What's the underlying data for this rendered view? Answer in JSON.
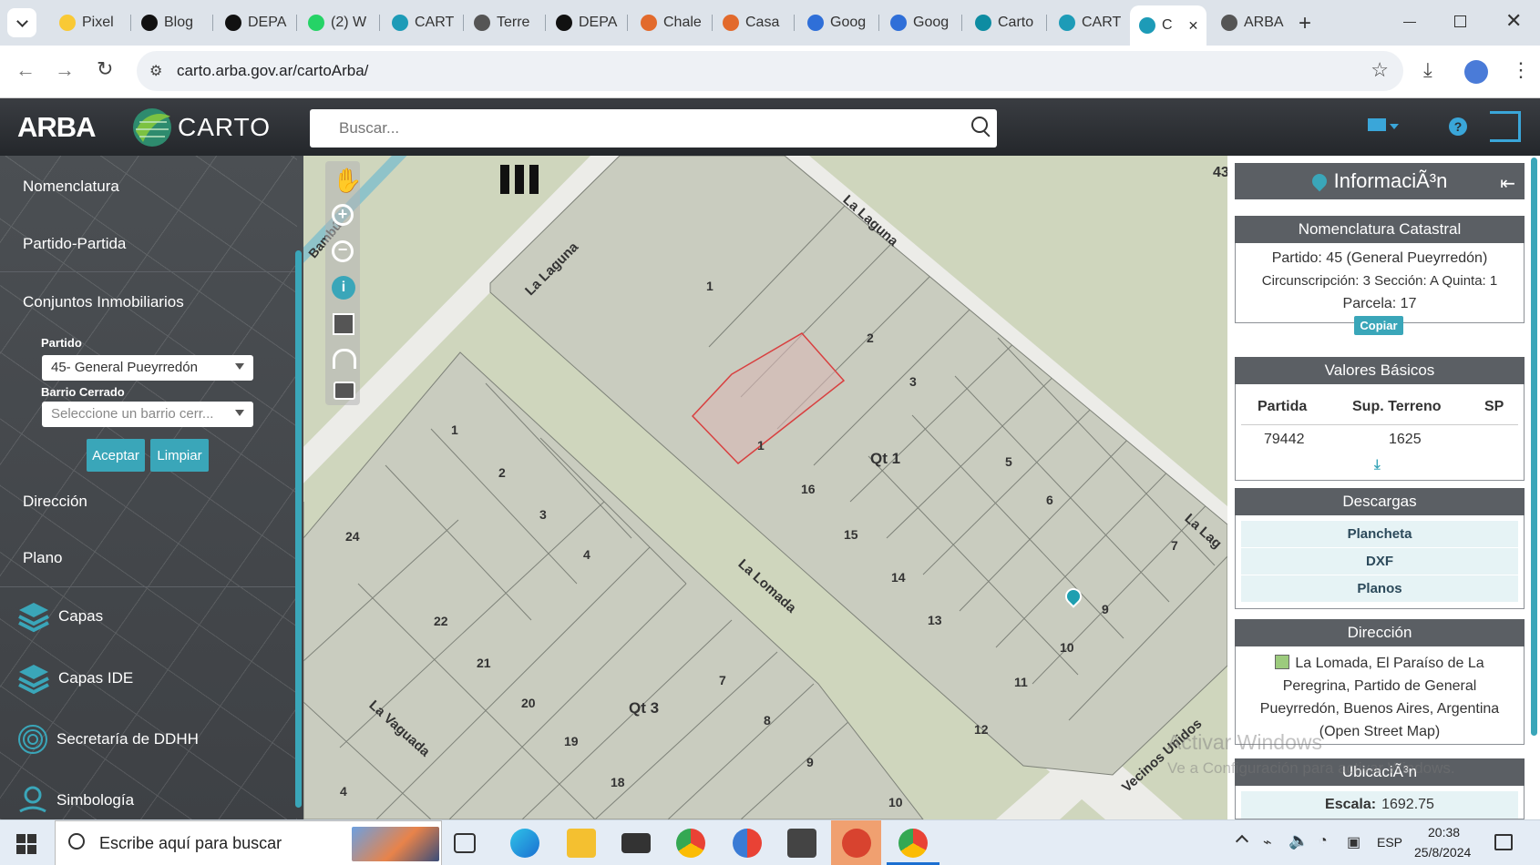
{
  "browser": {
    "tabs": [
      {
        "label": "Pixel",
        "color": "#f9c935"
      },
      {
        "label": "Blog",
        "color": "#111111"
      },
      {
        "label": "DEPA",
        "color": "#111111"
      },
      {
        "label": "(2) W",
        "color": "#25d366"
      },
      {
        "label": "CART",
        "color": "#1d9bb7"
      },
      {
        "label": "Terre",
        "color": "#555555"
      },
      {
        "label": "DEPA",
        "color": "#111111"
      },
      {
        "label": "Chale",
        "color": "#e26a2c"
      },
      {
        "label": "Casa",
        "color": "#e26a2c"
      },
      {
        "label": "Goog",
        "color": "#2f6fd8"
      },
      {
        "label": "Goog",
        "color": "#2f6fd8"
      },
      {
        "label": "Carto",
        "color": "#0e8ca2"
      },
      {
        "label": "CART",
        "color": "#1d9bb7"
      },
      {
        "label": "C",
        "color": "#1d9bb7"
      },
      {
        "label": "ARBA",
        "color": "#555555"
      }
    ],
    "url": "carto.arba.gov.ar/cartoArba/"
  },
  "app": {
    "brand": "ARBA",
    "logo_text": "CARTO",
    "search_placeholder": "Buscar..."
  },
  "sidebar": {
    "items": [
      "Nomenclatura",
      "Partido-Partida",
      "Conjuntos Inmobiliarios",
      "Dirección",
      "Plano"
    ],
    "partido_label": "Partido",
    "partido_value": "45- General Pueyrredón",
    "barrio_label": "Barrio Cerrado",
    "barrio_placeholder": "Seleccione un barrio cerr...",
    "accept": "Aceptar",
    "clear": "Limpiar",
    "layer_items": [
      "Capas",
      "Capas IDE",
      "Secretaría de DDHH",
      "Simbología"
    ]
  },
  "map": {
    "corner_label": "43",
    "streets": [
      "La Laguna",
      "La Laguna",
      "La Lomada",
      "La Vaguada",
      "Vecinos Unidos",
      "Bambú",
      "La Lag"
    ],
    "block_labels": [
      "Qt 1",
      "Qt 3"
    ],
    "lots_qt1": [
      "1",
      "2",
      "3",
      "1",
      "16",
      "15",
      "14",
      "5",
      "6",
      "7",
      "13",
      "9",
      "10",
      "11",
      "12"
    ],
    "lots_qt3": [
      "1",
      "2",
      "3",
      "4",
      "24",
      "22",
      "21",
      "20",
      "19",
      "18",
      "7",
      "8",
      "9",
      "10",
      "4"
    ]
  },
  "info": {
    "title": "InformaciÃ³n",
    "nomen_hd": "Nomenclatura Catastral",
    "nomen_lines": [
      "Partido: 45 (General Pueyrredón)",
      "Circunscripción: 3 Sección: A Quinta: 1",
      "Parcela: 17"
    ],
    "copy": "Copiar",
    "valores_hd": "Valores Básicos",
    "table_headers": [
      "Partida",
      "Sup. Terreno",
      "SP"
    ],
    "table_row": [
      "79442",
      "1625",
      ""
    ],
    "descargas_hd": "Descargas",
    "downloads": [
      "Plancheta",
      "DXF",
      "Planos"
    ],
    "direccion_hd": "Dirección",
    "address": "La Lomada, El Paraíso de La Peregrina, Partido de General Pueyrredón, Buenos Aires, Argentina (Open Street Map)",
    "ubicacion_hd": "UbicaciÃ³n",
    "scale_label": "Escala:",
    "scale_value": "1692.75",
    "watermark1": "Activar Windows",
    "watermark2": "Ve a Configuración para activar Windows."
  },
  "taskbar": {
    "search_placeholder": "Escribe aquí para buscar",
    "lang": "ESP",
    "time": "20:38",
    "date": "25/8/2024"
  }
}
